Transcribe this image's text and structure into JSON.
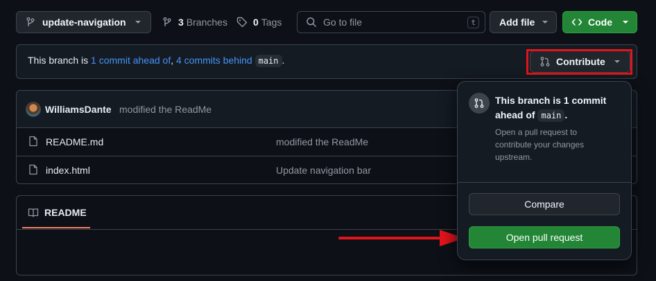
{
  "topbar": {
    "branch": "update-navigation",
    "branches_count": "3",
    "branches_label": "Branches",
    "tags_count": "0",
    "tags_label": "Tags",
    "search_placeholder": "Go to file",
    "search_shortcut": "t",
    "add_file_label": "Add file",
    "code_label": "Code"
  },
  "status": {
    "prefix": "This branch is",
    "ahead": "1 commit ahead of",
    "comma": ",",
    "behind": "4 commits behind",
    "base": "main",
    "period": ".",
    "contribute_label": "Contribute"
  },
  "commit": {
    "author": "WilliamsDante",
    "message": "modified the ReadMe"
  },
  "files": [
    {
      "name": "README.md",
      "message": "modified the ReadMe"
    },
    {
      "name": "index.html",
      "message": "Update navigation bar"
    }
  ],
  "readme": {
    "tab_label": "README"
  },
  "popover": {
    "title_pre": "This branch is 1 commit",
    "title_mid": "ahead of",
    "title_base": "main",
    "title_end": ".",
    "description": "Open a pull request to contribute your changes upstream.",
    "compare_label": "Compare",
    "open_pr_label": "Open pull request"
  },
  "colors": {
    "bg": "#0d1117",
    "green": "#238636",
    "link": "#4493f8",
    "annotation_red": "#e3141b"
  }
}
